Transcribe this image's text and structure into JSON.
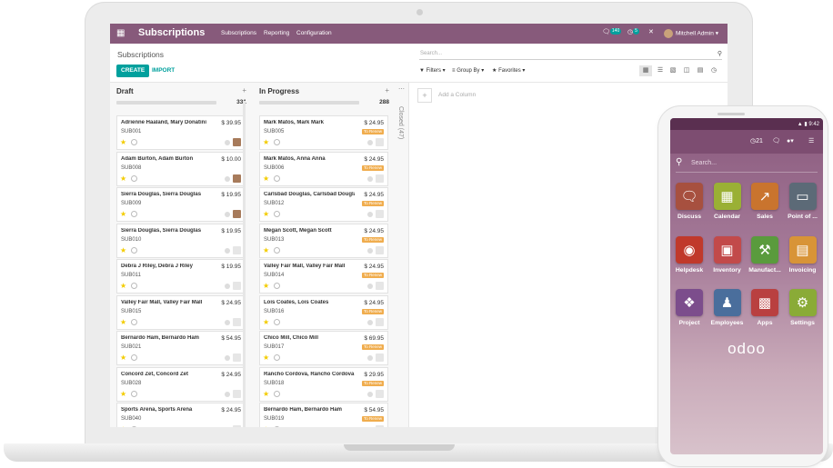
{
  "laptop": {
    "navbar": {
      "app_title": "Subscriptions",
      "menu": [
        "Subscriptions",
        "Reporting",
        "Configuration"
      ],
      "chat_count": "140",
      "activity_count": "5",
      "user_name": "Mitchell Admin"
    },
    "breadcrumb": "Subscriptions",
    "buttons": {
      "create": "CREATE",
      "import": "IMPORT"
    },
    "search": {
      "placeholder": "Search..."
    },
    "filters": {
      "filters": "Filters",
      "group_by": "Group By",
      "favorites": "Favorites"
    },
    "columns": [
      {
        "title": "Draft",
        "count": "331",
        "cards": [
          {
            "name": "Adrienne Haaland, Mary Donatini",
            "price": "$ 39.95",
            "ref": "SUB001",
            "tag": "",
            "has_user": true
          },
          {
            "name": "Adam Burton, Adam Burton",
            "price": "$ 10.00",
            "ref": "SUB008",
            "tag": "",
            "has_user": true
          },
          {
            "name": "Sierra Douglas, Sierra Douglas",
            "price": "$ 19.95",
            "ref": "SUB009",
            "tag": "",
            "has_user": true
          },
          {
            "name": "Sierra Douglas, Sierra Douglas",
            "price": "$ 19.95",
            "ref": "SUB010",
            "tag": "",
            "has_user": false
          },
          {
            "name": "Debra J Riley, Debra J Riley",
            "price": "$ 19.95",
            "ref": "SUB011",
            "tag": "",
            "has_user": false
          },
          {
            "name": "Valley Fair Mall, Valley Fair Mall",
            "price": "$ 24.95",
            "ref": "SUB015",
            "tag": "",
            "has_user": false
          },
          {
            "name": "Bernardo Ham, Bernardo Ham",
            "price": "$ 54.95",
            "ref": "SUB021",
            "tag": "",
            "has_user": false
          },
          {
            "name": "Concord Zet, Concord Zet",
            "price": "$ 24.95",
            "ref": "SUB028",
            "tag": "",
            "has_user": false
          },
          {
            "name": "Sports Arena, Sports Arena",
            "price": "$ 24.95",
            "ref": "SUB040",
            "tag": "",
            "has_user": false
          }
        ]
      },
      {
        "title": "In Progress",
        "count": "288",
        "cards": [
          {
            "name": "Mark Matos, Mark Mark",
            "price": "$ 24.95",
            "ref": "SUB005",
            "tag": "To Renew",
            "has_user": false
          },
          {
            "name": "Mark Matos, Anna Anna",
            "price": "$ 24.95",
            "ref": "SUB006",
            "tag": "To Renew",
            "has_user": false
          },
          {
            "name": "Carlsbad Douglas, Carlsbad Douglas",
            "price": "$ 24.95",
            "ref": "SUB012",
            "tag": "To Renew",
            "has_user": false
          },
          {
            "name": "Megan Scott, Megan Scott",
            "price": "$ 24.95",
            "ref": "SUB013",
            "tag": "To Renew",
            "has_user": false
          },
          {
            "name": "Valley Fair Mall, Valley Fair Mall",
            "price": "$ 24.95",
            "ref": "SUB014",
            "tag": "To Renew",
            "has_user": false
          },
          {
            "name": "Lois Coates, Lois Coates",
            "price": "$ 24.95",
            "ref": "SUB016",
            "tag": "To Renew",
            "has_user": false
          },
          {
            "name": "Chico Mill, Chico Mill",
            "price": "$ 69.95",
            "ref": "SUB017",
            "tag": "To Renew",
            "has_user": false
          },
          {
            "name": "Rancho Cordova, Rancho Cordova",
            "price": "$ 29.95",
            "ref": "SUB018",
            "tag": "To Renew",
            "has_user": false
          },
          {
            "name": "Bernardo Ham, Bernardo Ham",
            "price": "$ 54.95",
            "ref": "SUB019",
            "tag": "To Renew",
            "has_user": false
          }
        ]
      }
    ],
    "closed_column": "Closed (47)",
    "add_column": "Add a Column"
  },
  "phone": {
    "status_time": "9:42",
    "nav_count": "21",
    "search_placeholder": "Search...",
    "apps": [
      {
        "label": "Discuss",
        "icon": "chat-icon",
        "color": "#a7503f"
      },
      {
        "label": "Calendar",
        "icon": "calendar-icon",
        "color": "#9ab035"
      },
      {
        "label": "Sales",
        "icon": "chart-icon",
        "color": "#c9742e"
      },
      {
        "label": "Point of ...",
        "icon": "monitor-icon",
        "color": "#5c6a77"
      },
      {
        "label": "Helpdesk",
        "icon": "lifebuoy-icon",
        "color": "#c0392b"
      },
      {
        "label": "Inventory",
        "icon": "box-icon",
        "color": "#c24a4a"
      },
      {
        "label": "Manufact...",
        "icon": "wrench-icon",
        "color": "#5a9b3d"
      },
      {
        "label": "Invoicing",
        "icon": "invoice-icon",
        "color": "#d89437"
      },
      {
        "label": "Project",
        "icon": "puzzle-icon",
        "color": "#7c4d8c"
      },
      {
        "label": "Employees",
        "icon": "people-icon",
        "color": "#4a6e9c"
      },
      {
        "label": "Apps",
        "icon": "cubes-icon",
        "color": "#b94040"
      },
      {
        "label": "Settings",
        "icon": "gear-icon",
        "color": "#8aab37"
      }
    ],
    "logo": "odoo"
  }
}
